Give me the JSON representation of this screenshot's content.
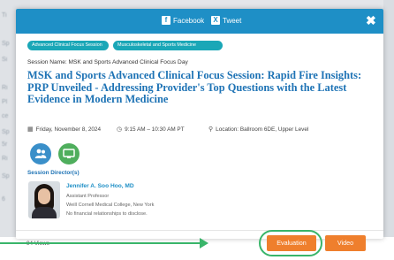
{
  "background": {
    "left_snippets": [
      "Ti",
      "Sp",
      "Si",
      "Ri",
      "Pl",
      "ce",
      "Sp",
      "5r",
      "Ri",
      "Sp",
      "6"
    ]
  },
  "header": {
    "facebook_label": "Facebook",
    "tweet_label": "Tweet",
    "close_symbol": "✖",
    "bg_color": "#1e8fc6"
  },
  "tags": [
    "Advanced Clinical Focus Session",
    "Musculoskeletal and Sports Medicine"
  ],
  "session_name": "Session Name: MSK and Sports Advanced Clinical Focus Day",
  "title": "MSK and Sports Advanced Clinical Focus Session: Rapid Fire Insights: PRP Unveiled - Addressing Provider's Top Questions with the Latest Evidence in Modern Medicine",
  "meta": {
    "date": "Friday, November 8, 2024",
    "time": "9:15 AM – 10:30 AM PT",
    "location": "Location: Ballroom 6DE, Upper Level"
  },
  "icons": {
    "people": "people-icon",
    "screen": "monitor-icon",
    "people_color": "#3a8fc9",
    "screen_color": "#4fae5d"
  },
  "directors": {
    "heading": "Session Director(s)",
    "name": "Jennifer A. Soo Hoo, MD",
    "role": "Assistant Professor",
    "affiliation": "Weill Cornell Medical College, New York",
    "disclosure": "No financial relationships to disclose."
  },
  "footer": {
    "views": "94 Views",
    "evaluation_label": "Evaluation",
    "video_label": "Video",
    "button_color": "#ef7f2d",
    "highlight_color": "#39b56a"
  }
}
